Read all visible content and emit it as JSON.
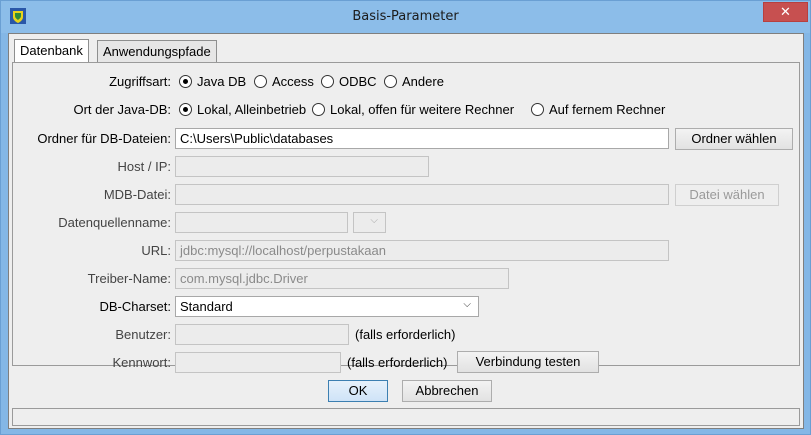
{
  "window": {
    "title": "Basis-Parameter",
    "close_glyph": "✕"
  },
  "tabs": [
    {
      "label": "Datenbank",
      "active": true
    },
    {
      "label": "Anwendungspfade",
      "active": false
    }
  ],
  "form": {
    "access_type": {
      "label": "Zugriffsart:",
      "options": [
        "Java DB",
        "Access",
        "ODBC",
        "Andere"
      ],
      "selected": "Java DB"
    },
    "db_location": {
      "label": "Ort der Java-DB:",
      "options": [
        "Lokal, Alleinbetrieb",
        "Lokal, offen für weitere Rechner",
        "Auf fernem Rechner"
      ],
      "selected": "Lokal, Alleinbetrieb"
    },
    "db_folder": {
      "label": "Ordner für DB-Dateien:",
      "value": "C:\\Users\\Public\\databases",
      "button": "Ordner wählen"
    },
    "host": {
      "label": "Host / IP:",
      "value": ""
    },
    "mdb_file": {
      "label": "MDB-Datei:",
      "value": "",
      "button": "Datei wählen"
    },
    "datasource": {
      "label": "Datenquellenname:",
      "value": ""
    },
    "url": {
      "label": "URL:",
      "value": "jdbc:mysql://localhost/perpustakaan"
    },
    "driver": {
      "label": "Treiber-Name:",
      "value": "com.mysql.jdbc.Driver"
    },
    "charset": {
      "label": "DB-Charset:",
      "value": "Standard"
    },
    "user": {
      "label": "Benutzer:",
      "value": "",
      "hint": "(falls erforderlich)"
    },
    "password": {
      "label": "Kennwort:",
      "value": "",
      "hint": "(falls erforderlich)",
      "button": "Verbindung testen"
    }
  },
  "footer": {
    "ok": "OK",
    "cancel": "Abbrechen"
  },
  "colors": {
    "titlebar": "#8cbde9",
    "close": "#c75050",
    "dialog_bg": "#eeeeee"
  },
  "icons": {
    "app": "app-shield-icon",
    "close": "close-icon",
    "dropdown": "chevron-down-icon"
  }
}
